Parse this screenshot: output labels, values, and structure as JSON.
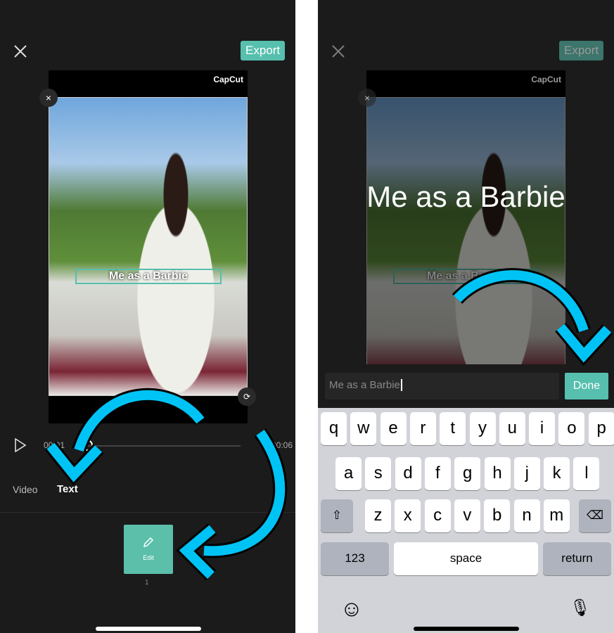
{
  "left": {
    "export_label": "Export",
    "logo": "CapCut",
    "caption": "Me as a Barbie",
    "time_current": "00:01",
    "time_total": "00:06",
    "tabs": [
      {
        "label": "Video"
      },
      {
        "label": "Text"
      }
    ],
    "clip": {
      "label": "Edit",
      "index": "1"
    }
  },
  "right": {
    "export_label": "Export",
    "logo": "CapCut",
    "big_caption": "Me as a Barbie",
    "caption": "Me as a Barbie",
    "input_value": "Me as a Barbie",
    "done_label": "Done",
    "keyboard": {
      "row1": [
        "q",
        "w",
        "e",
        "r",
        "t",
        "y",
        "u",
        "i",
        "o",
        "p"
      ],
      "row2": [
        "a",
        "s",
        "d",
        "f",
        "g",
        "h",
        "j",
        "k",
        "l"
      ],
      "row3": [
        "z",
        "x",
        "c",
        "v",
        "b",
        "n",
        "m"
      ],
      "numbers": "123",
      "space": "space",
      "return": "return"
    }
  },
  "colors": {
    "accent": "#57bfae",
    "arrow": "#00c3f5",
    "background": "#1b1b1b"
  }
}
